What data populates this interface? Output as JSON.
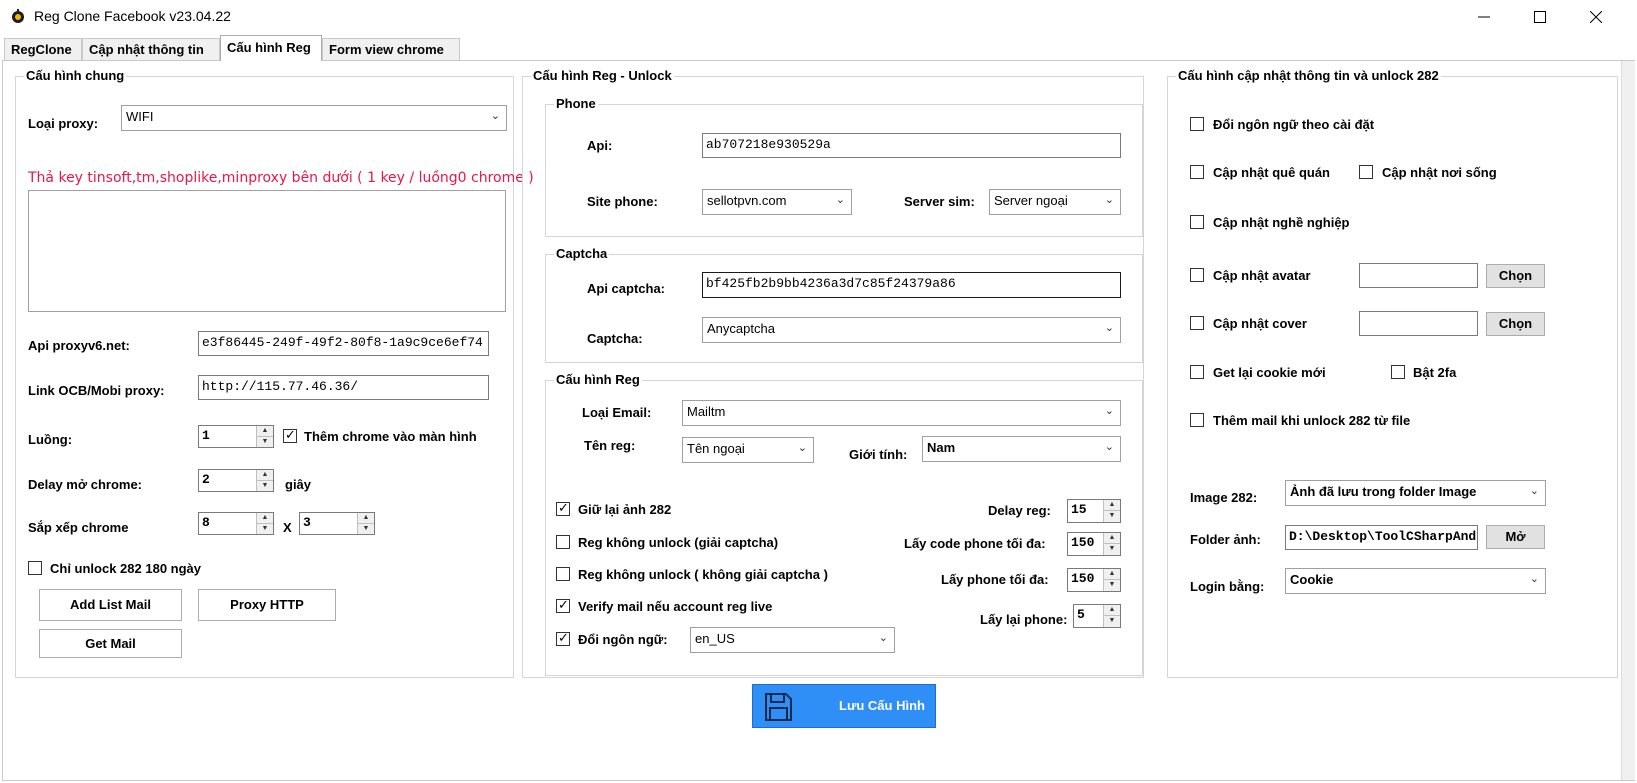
{
  "window": {
    "title": "Reg Clone Facebook v23.04.22",
    "minimize_icon": "minimize-icon",
    "maximize_icon": "maximize-icon",
    "close_icon": "close-icon"
  },
  "tabs": [
    {
      "label": "RegClone"
    },
    {
      "label": "Cập nhật thông tin"
    },
    {
      "label": "Cấu hình Reg"
    },
    {
      "label": "Form view chrome"
    }
  ],
  "general": {
    "title": "Cấu hình chung",
    "proxy_type_label": "Loại proxy:",
    "proxy_type_value": "WIFI",
    "key_hint": "Thả key tinsoft,tm,shoplike,minproxy bên dưới ( 1 key / luồng0 chrome )",
    "keys_text": "",
    "api_proxyv6_label": "Api proxyv6.net:",
    "api_proxyv6_value": "e3f86445-249f-49f2-80f8-1a9c9ce6ef74",
    "link_ocb_label": "Link OCB/Mobi proxy:",
    "link_ocb_value": "http://115.77.46.36/",
    "threads_label": "Luồng:",
    "threads_value": "1",
    "add_chrome_label": "Thêm chrome vào màn hình",
    "delay_label": "Delay mở chrome:",
    "delay_value": "2",
    "delay_unit": "giây",
    "arrange_label": "Sắp xếp chrome",
    "arrange_x": "8",
    "arrange_sep": "X",
    "arrange_y": "3",
    "unlock_180_label": "Chỉ unlock 282 180 ngày",
    "add_list_mail": "Add List Mail",
    "proxy_http": "Proxy HTTP",
    "get_mail": "Get Mail"
  },
  "reg_unlock": {
    "title": "Cấu hình Reg - Unlock",
    "phone": {
      "title": "Phone",
      "api_label": "Api:",
      "api_value": "ab707218e930529a",
      "site_label": "Site phone:",
      "site_value": "sellotpvn.com",
      "server_label": "Server sim:",
      "server_value": "Server ngoại"
    },
    "captcha": {
      "title": "Captcha",
      "api_label": "Api captcha:",
      "api_value": "bf425fb2b9bb4236a3d7c85f24379a86",
      "captcha_label": "Captcha:",
      "captcha_value": "Anycaptcha"
    },
    "reg": {
      "title": "Cấu hình Reg",
      "email_type_label": "Loại Email:",
      "email_type_value": "Mailtm",
      "reg_name_label": "Tên reg:",
      "reg_name_value": "Tên ngoại",
      "gender_label": "Giới tính:",
      "gender_value": "Nam",
      "keep_282_label": "Giữ lại ảnh 282",
      "no_unlock_captcha_label": "Reg không unlock (giải captcha)",
      "no_unlock_nocaptcha_label": "Reg không unlock ( không giải captcha )",
      "verify_mail_label": "Verify mail nếu account reg live",
      "change_lang_label": "Đổi ngôn ngữ:",
      "change_lang_value": "en_US",
      "delay_reg_label": "Delay reg:",
      "delay_reg_value": "15",
      "max_code_label": "Lấy code phone tối đa:",
      "max_code_value": "150",
      "max_phone_label": "Lấy phone tối đa:",
      "max_phone_value": "150",
      "retry_phone_label": "Lấy lại phone:",
      "retry_phone_value": "5"
    },
    "save_button": "Lưu Cấu Hình"
  },
  "update": {
    "title": "Cấu hình cập nhật thông tin và unlock 282",
    "change_lang": "Đổi ngôn ngữ theo cài đặt",
    "update_hometown": "Cập nhật quê quán",
    "update_residence": "Cập nhật nơi sống",
    "update_job": "Cập nhật nghề nghiệp",
    "update_avatar": "Cập nhật avatar",
    "avatar_value": "",
    "choose": "Chọn",
    "update_cover": "Cập nhật cover",
    "cover_value": "",
    "get_cookie": "Get lại cookie mới",
    "enable_2fa": "Bật 2fa",
    "add_mail_282": "Thêm mail khi unlock 282 từ file",
    "image_282_label": "Image 282:",
    "image_282_value": "Ảnh đã lưu trong folder Image",
    "folder_label": "Folder ảnh:",
    "folder_value": "D:\\Desktop\\ToolCSharpAnd",
    "open": "Mở",
    "login_label": "Login bằng:",
    "login_value": "Cookie"
  },
  "colors": {
    "hint_red": "#e8174b",
    "save_blue": "#2f8ff7",
    "check_on": "true"
  }
}
